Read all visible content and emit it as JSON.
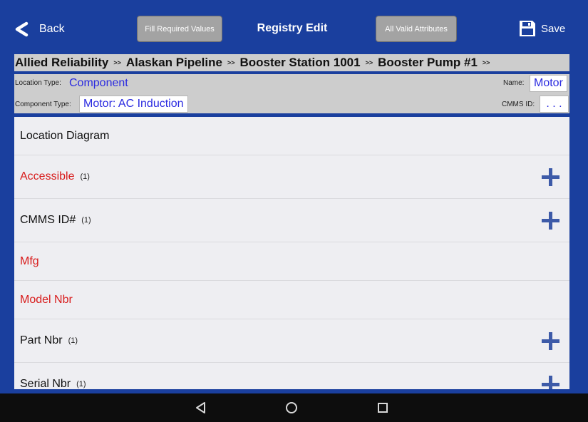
{
  "header": {
    "back_label": "Back",
    "fill_required_label": "Fill Required Values",
    "title": "Registry Edit",
    "all_valid_label": "All Valid Attributes",
    "save_label": "Save"
  },
  "breadcrumb": {
    "items": [
      "Allied Reliability",
      "Alaskan Pipeline",
      "Booster Station 1001",
      "Booster Pump #1"
    ],
    "separator": ">>"
  },
  "info": {
    "location_type_label": "Location Type:",
    "location_type_value": "Component",
    "component_type_label": "Component Type:",
    "component_type_value": "Motor: AC Induction",
    "name_label": "Name:",
    "name_value": "Motor",
    "cmms_label": "CMMS ID:",
    "cmms_value": ". . ."
  },
  "attributes": [
    {
      "label": "Location Diagram",
      "count": "",
      "color": "#111111",
      "has_add": false
    },
    {
      "label": "Accessible",
      "count": "(1)",
      "color": "#d81b1b",
      "has_add": true
    },
    {
      "label": "CMMS ID#",
      "count": "(1)",
      "color": "#111111",
      "has_add": true
    },
    {
      "label": "Mfg",
      "count": "",
      "color": "#d81b1b",
      "has_add": false
    },
    {
      "label": "Model Nbr",
      "count": "",
      "color": "#d81b1b",
      "has_add": false
    },
    {
      "label": "Part Nbr",
      "count": "(1)",
      "color": "#111111",
      "has_add": true
    },
    {
      "label": "Serial Nbr",
      "count": "(1)",
      "color": "#111111",
      "has_add": true
    }
  ],
  "colors": {
    "header_bg": "#1a3f9e",
    "panel_gray": "#cdcdcd",
    "value_blue": "#2a2ae0",
    "required_red": "#d81b1b",
    "add_icon_blue": "#3d5aa8"
  },
  "icons": {
    "back": "back-arrow-icon",
    "save": "floppy-disk-icon",
    "add": "plus-icon",
    "nav_back": "triangle-back-icon",
    "nav_home": "circle-home-icon",
    "nav_recents": "square-recents-icon"
  }
}
